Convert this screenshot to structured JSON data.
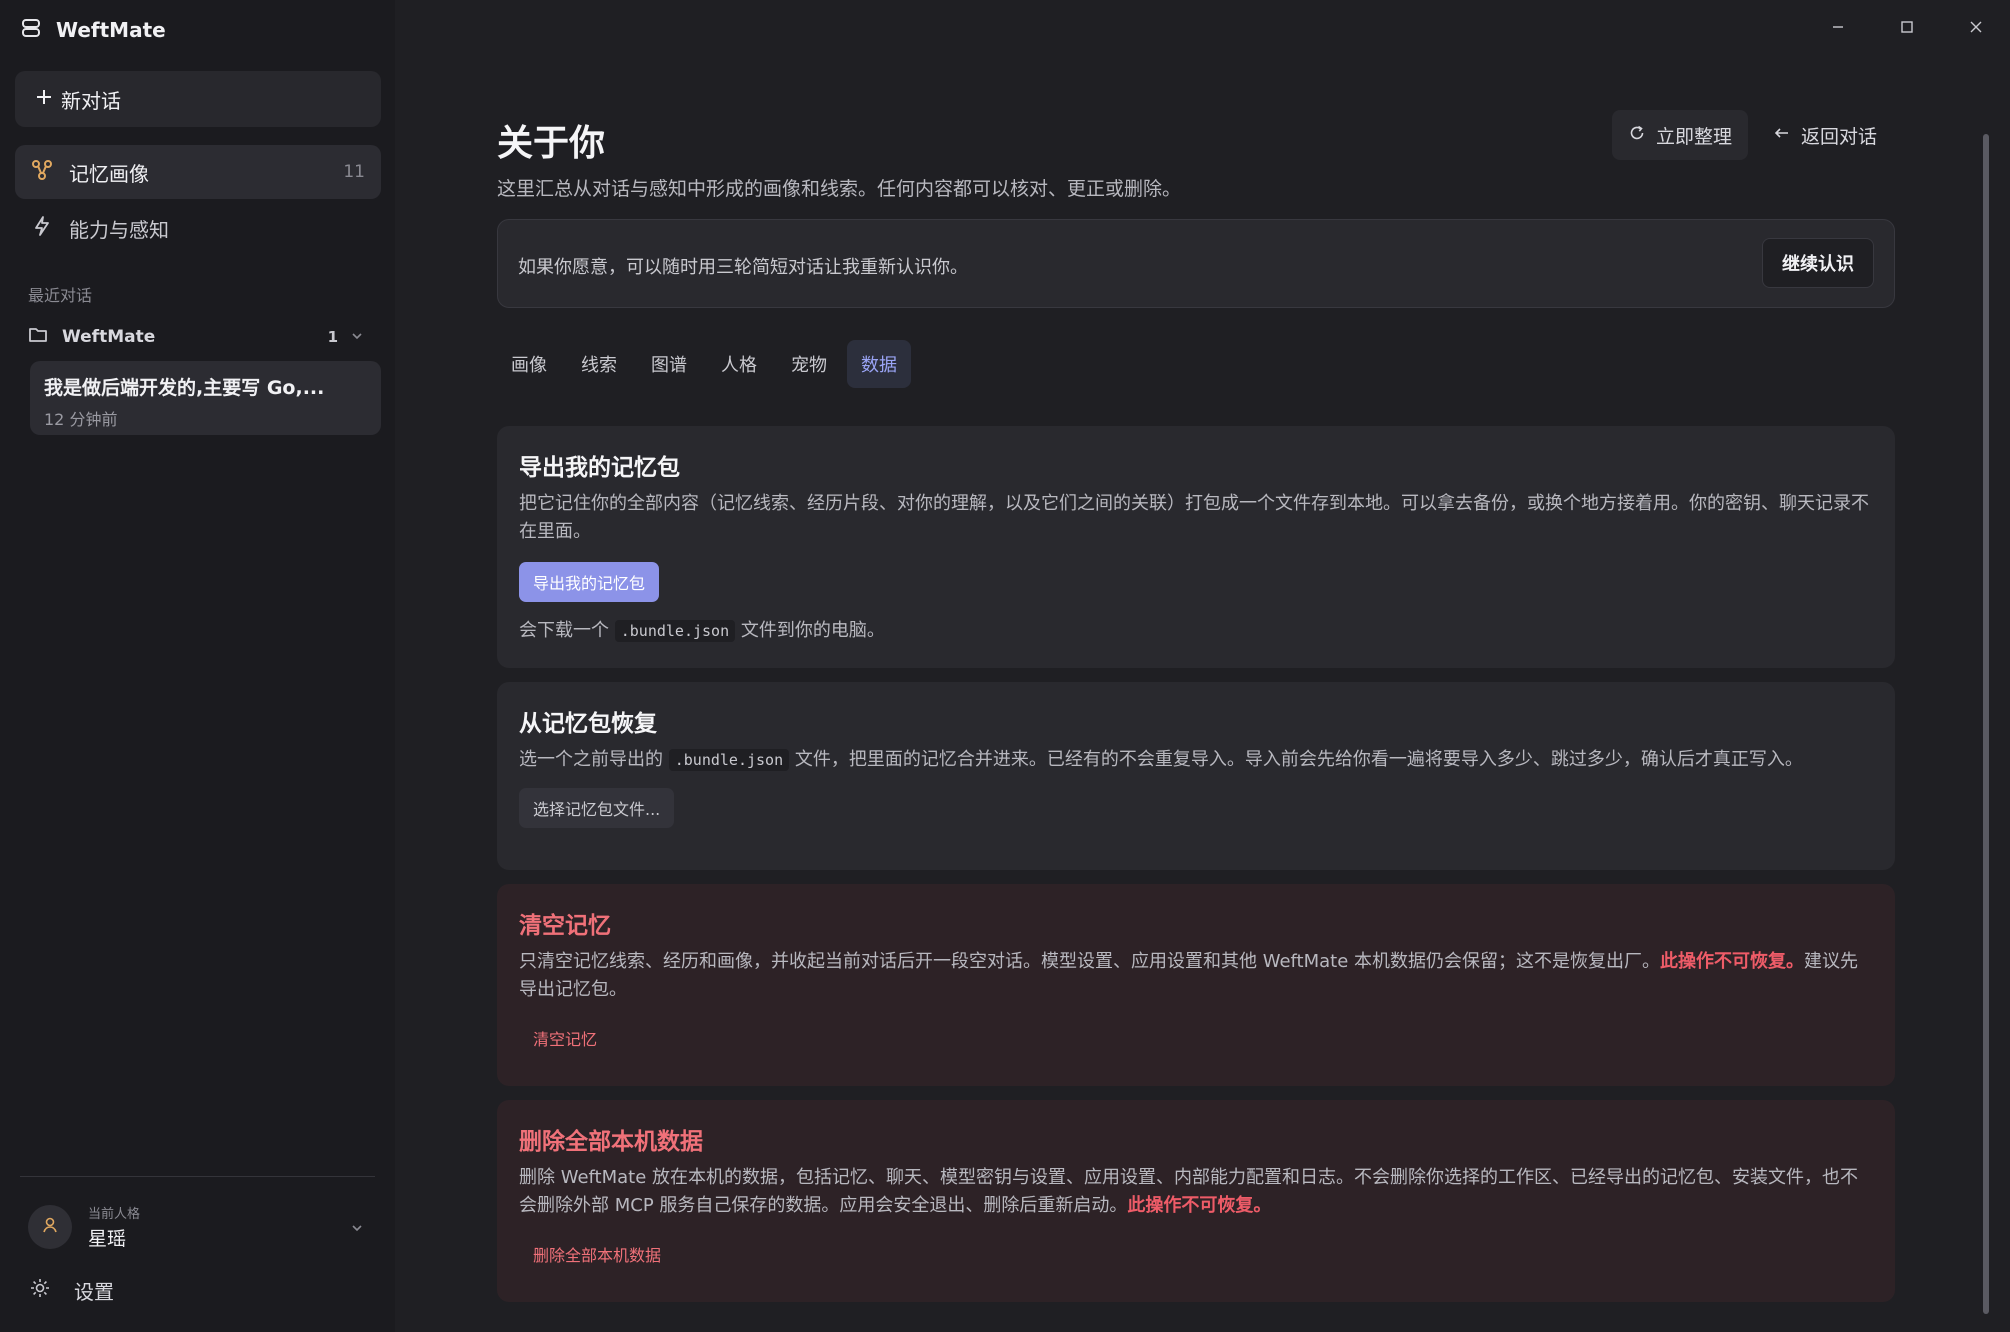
{
  "app": {
    "name": "WeftMate"
  },
  "sidebar": {
    "new_chat": "新对话",
    "nav": [
      {
        "label": "记忆画像",
        "count": "11"
      },
      {
        "label": "能力与感知"
      }
    ],
    "recent_label": "最近对话",
    "folder": {
      "name": "WeftMate",
      "count": "1"
    },
    "conversation": {
      "title": "我是做后端开发的,主要写 Go,...",
      "time": "12 分钟前"
    },
    "persona": {
      "label": "当前人格",
      "name": "星瑶"
    },
    "settings_label": "设置"
  },
  "header": {
    "title": "关于你",
    "subtitle": "这里汇总从对话与感知中形成的画像和线索。任何内容都可以核对、更正或删除。",
    "tidy_label": "立即整理",
    "back_label": "返回对话"
  },
  "banner": {
    "text": "如果你愿意，可以随时用三轮简短对话让我重新认识你。",
    "button": "继续认识"
  },
  "tabs": [
    "画像",
    "线索",
    "图谱",
    "人格",
    "宠物",
    "数据"
  ],
  "active_tab": "数据",
  "cards": {
    "export": {
      "title": "导出我的记忆包",
      "desc": "把它记住你的全部内容（记忆线索、经历片段、对你的理解，以及它们之间的关联）打包成一个文件存到本地。可以拿去备份，或换个地方接着用。你的密钥、聊天记录不在里面。",
      "button": "导出我的记忆包",
      "note_before": "会下载一个",
      "note_code": ".bundle.json",
      "note_after": "文件到你的电脑。"
    },
    "restore": {
      "title": "从记忆包恢复",
      "desc_before": "选一个之前导出的",
      "desc_code": ".bundle.json",
      "desc_after": "文件，把里面的记忆合并进来。已经有的不会重复导入。导入前会先给你看一遍将要导入多少、跳过多少，确认后才真正写入。",
      "button": "选择记忆包文件..."
    },
    "clear": {
      "title": "清空记忆",
      "desc_before": "只清空记忆线索、经历和画像，并收起当前对话后开一段空对话。模型设置、应用设置和其他 WeftMate 本机数据仍会保留；这不是恢复出厂。",
      "desc_warn": "此操作不可恢复。",
      "desc_after": "建议先导出记忆包。",
      "button": "清空记忆"
    },
    "delete_all": {
      "title": "删除全部本机数据",
      "desc_before": "删除 WeftMate 放在本机的数据，包括记忆、聊天、模型密钥与设置、应用设置、内部能力配置和日志。不会删除你选择的工作区、已经导出的记忆包、安装文件，也不会删除外部 MCP 服务自己保存的数据。应用会安全退出、删除后重新启动。",
      "desc_warn": "此操作不可恢复。",
      "button": "删除全部本机数据"
    }
  },
  "icons": {
    "app": "database-icon",
    "new_chat": "plus-icon",
    "memory": "graph-nodes-icon",
    "abilities": "lightning-icon",
    "folder": "folder-icon",
    "chevron": "chevron-down-icon",
    "avatar": "user-icon",
    "settings": "sun-gear-icon",
    "tidy": "refresh-icon",
    "back": "arrow-left-icon"
  },
  "colors": {
    "accent": "#8c93e8",
    "danger": "#ee5c68",
    "background": "#1f1f23",
    "sidebar": "#1b1b1f"
  }
}
